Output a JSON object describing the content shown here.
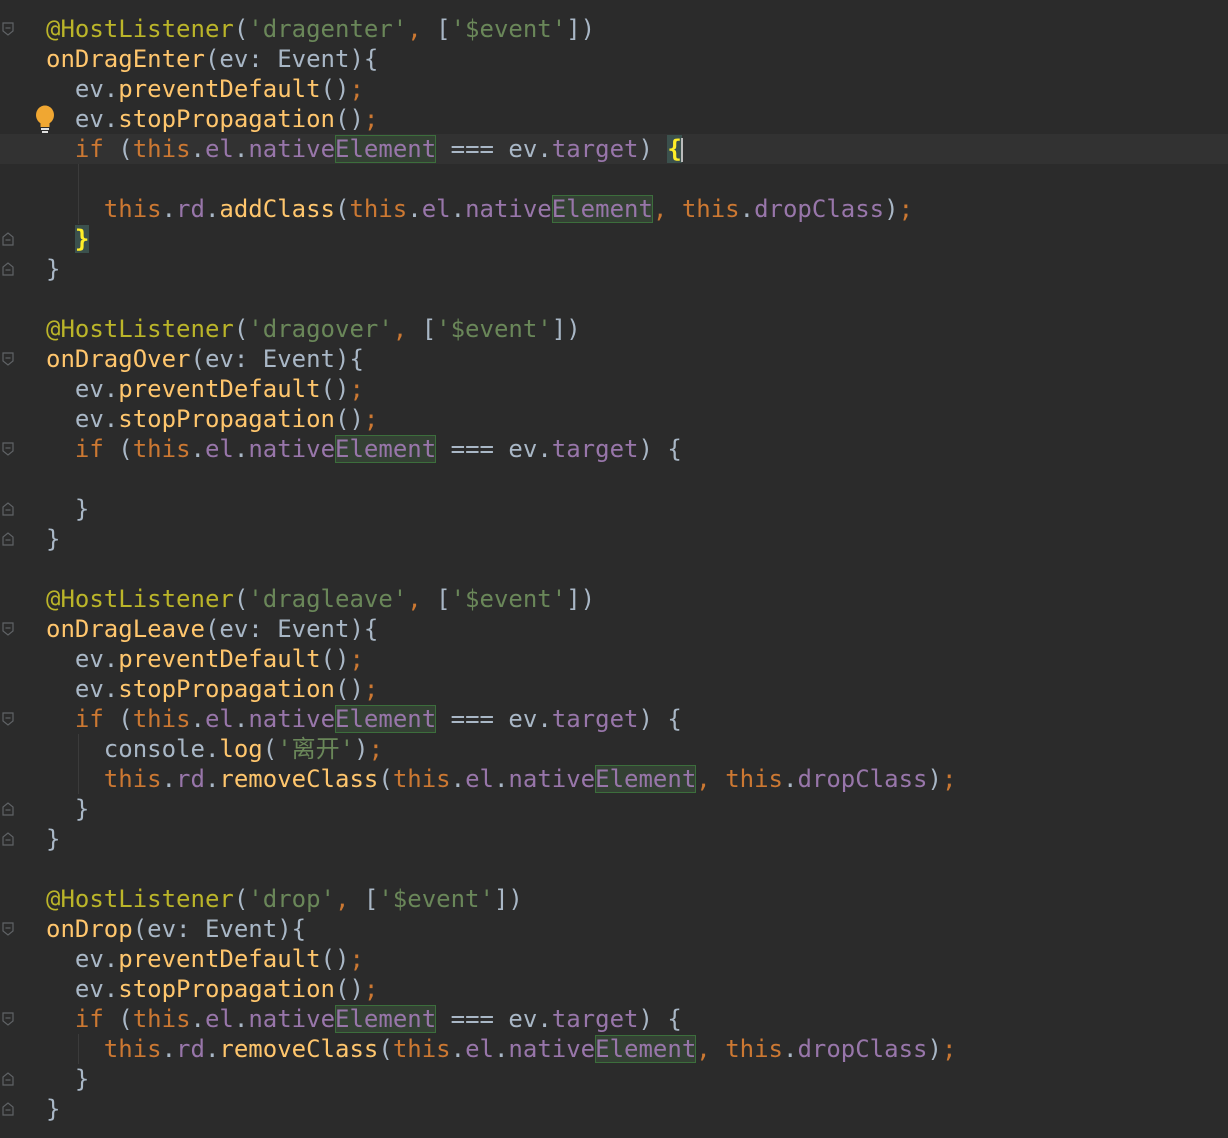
{
  "editor": {
    "colors": {
      "background": "#2b2b2b",
      "text": "#a9b7c6",
      "annotation": "#bbb529",
      "string": "#6a8759",
      "keyword": "#cc7832",
      "function": "#ffc66d",
      "property": "#9876aa",
      "highlight_bg": "#344134",
      "brace_match": "#ffef28"
    },
    "gutter": {
      "fold_markers": [
        "open",
        "",
        "",
        "",
        "open",
        "",
        "",
        "close",
        "close",
        "",
        "",
        "open",
        "",
        "",
        "open",
        "",
        "close",
        "close",
        "",
        "",
        "open",
        "",
        "",
        "open",
        "",
        "",
        "close",
        "close",
        "",
        "",
        "open",
        "",
        "",
        "open",
        "",
        "close",
        "close"
      ],
      "bulb_icon": "intention-bulb-icon"
    },
    "lines": [
      [
        {
          "t": "@HostListener",
          "c": "ann"
        },
        {
          "t": "(",
          "c": "txt"
        },
        {
          "t": "'dragenter'",
          "c": "str"
        },
        {
          "t": ", ",
          "c": "kw"
        },
        {
          "t": "[",
          "c": "txt"
        },
        {
          "t": "'$event'",
          "c": "str"
        },
        {
          "t": "])",
          "c": "txt"
        }
      ],
      [
        {
          "t": "onDragEnter",
          "c": "fn"
        },
        {
          "t": "(ev: Event){",
          "c": "txt"
        }
      ],
      [
        {
          "t": "  ev.",
          "c": "txt"
        },
        {
          "t": "preventDefault",
          "c": "fn"
        },
        {
          "t": "()",
          "c": "txt"
        },
        {
          "t": ";",
          "c": "kw"
        }
      ],
      [
        {
          "t": "  ev.",
          "c": "txt"
        },
        {
          "t": "stopPropagation",
          "c": "fn"
        },
        {
          "t": "()",
          "c": "txt"
        },
        {
          "t": ";",
          "c": "kw"
        }
      ],
      [
        {
          "t": "  ",
          "c": "txt"
        },
        {
          "t": "if",
          "c": "kw"
        },
        {
          "t": " (",
          "c": "txt"
        },
        {
          "t": "this",
          "c": "kw"
        },
        {
          "t": ".",
          "c": "txt"
        },
        {
          "t": "el",
          "c": "prop"
        },
        {
          "t": ".",
          "c": "txt"
        },
        {
          "t": "native",
          "c": "prop"
        },
        {
          "t": "Element",
          "c": "prop hl"
        },
        {
          "t": " === ev.",
          "c": "txt"
        },
        {
          "t": "target",
          "c": "prop"
        },
        {
          "t": ") ",
          "c": "txt"
        },
        {
          "t": "{",
          "c": "brace"
        }
      ],
      [],
      [
        {
          "t": "    ",
          "c": "txt"
        },
        {
          "t": "this",
          "c": "kw"
        },
        {
          "t": ".",
          "c": "txt"
        },
        {
          "t": "rd",
          "c": "prop"
        },
        {
          "t": ".",
          "c": "txt"
        },
        {
          "t": "addClass",
          "c": "fn"
        },
        {
          "t": "(",
          "c": "txt"
        },
        {
          "t": "this",
          "c": "kw"
        },
        {
          "t": ".",
          "c": "txt"
        },
        {
          "t": "el",
          "c": "prop"
        },
        {
          "t": ".",
          "c": "txt"
        },
        {
          "t": "native",
          "c": "prop"
        },
        {
          "t": "Element",
          "c": "prop hl"
        },
        {
          "t": ", ",
          "c": "kw"
        },
        {
          "t": "this",
          "c": "kw"
        },
        {
          "t": ".",
          "c": "txt"
        },
        {
          "t": "dropClass",
          "c": "prop"
        },
        {
          "t": ")",
          "c": "txt"
        },
        {
          "t": ";",
          "c": "kw"
        }
      ],
      [
        {
          "t": "  ",
          "c": "txt"
        },
        {
          "t": "}",
          "c": "brace"
        }
      ],
      [
        {
          "t": "}",
          "c": "txt"
        }
      ],
      [],
      [
        {
          "t": "@HostListener",
          "c": "ann"
        },
        {
          "t": "(",
          "c": "txt"
        },
        {
          "t": "'dragover'",
          "c": "str"
        },
        {
          "t": ", ",
          "c": "kw"
        },
        {
          "t": "[",
          "c": "txt"
        },
        {
          "t": "'$event'",
          "c": "str"
        },
        {
          "t": "])",
          "c": "txt"
        }
      ],
      [
        {
          "t": "onDragOver",
          "c": "fn"
        },
        {
          "t": "(ev: Event){",
          "c": "txt"
        }
      ],
      [
        {
          "t": "  ev.",
          "c": "txt"
        },
        {
          "t": "preventDefault",
          "c": "fn"
        },
        {
          "t": "()",
          "c": "txt"
        },
        {
          "t": ";",
          "c": "kw"
        }
      ],
      [
        {
          "t": "  ev.",
          "c": "txt"
        },
        {
          "t": "stopPropagation",
          "c": "fn"
        },
        {
          "t": "()",
          "c": "txt"
        },
        {
          "t": ";",
          "c": "kw"
        }
      ],
      [
        {
          "t": "  ",
          "c": "txt"
        },
        {
          "t": "if",
          "c": "kw"
        },
        {
          "t": " (",
          "c": "txt"
        },
        {
          "t": "this",
          "c": "kw"
        },
        {
          "t": ".",
          "c": "txt"
        },
        {
          "t": "el",
          "c": "prop"
        },
        {
          "t": ".",
          "c": "txt"
        },
        {
          "t": "native",
          "c": "prop"
        },
        {
          "t": "Element",
          "c": "prop hl"
        },
        {
          "t": " === ev.",
          "c": "txt"
        },
        {
          "t": "target",
          "c": "prop"
        },
        {
          "t": ") {",
          "c": "txt"
        }
      ],
      [],
      [
        {
          "t": "  }",
          "c": "txt"
        }
      ],
      [
        {
          "t": "}",
          "c": "txt"
        }
      ],
      [],
      [
        {
          "t": "@HostListener",
          "c": "ann"
        },
        {
          "t": "(",
          "c": "txt"
        },
        {
          "t": "'dragleave'",
          "c": "str"
        },
        {
          "t": ", ",
          "c": "kw"
        },
        {
          "t": "[",
          "c": "txt"
        },
        {
          "t": "'$event'",
          "c": "str"
        },
        {
          "t": "])",
          "c": "txt"
        }
      ],
      [
        {
          "t": "onDragLeave",
          "c": "fn"
        },
        {
          "t": "(ev: Event){",
          "c": "txt"
        }
      ],
      [
        {
          "t": "  ev.",
          "c": "txt"
        },
        {
          "t": "preventDefault",
          "c": "fn"
        },
        {
          "t": "()",
          "c": "txt"
        },
        {
          "t": ";",
          "c": "kw"
        }
      ],
      [
        {
          "t": "  ev.",
          "c": "txt"
        },
        {
          "t": "stopPropagation",
          "c": "fn"
        },
        {
          "t": "()",
          "c": "txt"
        },
        {
          "t": ";",
          "c": "kw"
        }
      ],
      [
        {
          "t": "  ",
          "c": "txt"
        },
        {
          "t": "if",
          "c": "kw"
        },
        {
          "t": " (",
          "c": "txt"
        },
        {
          "t": "this",
          "c": "kw"
        },
        {
          "t": ".",
          "c": "txt"
        },
        {
          "t": "el",
          "c": "prop"
        },
        {
          "t": ".",
          "c": "txt"
        },
        {
          "t": "native",
          "c": "prop"
        },
        {
          "t": "Element",
          "c": "prop hl"
        },
        {
          "t": " === ev.",
          "c": "txt"
        },
        {
          "t": "target",
          "c": "prop"
        },
        {
          "t": ") {",
          "c": "txt"
        }
      ],
      [
        {
          "t": "    console.",
          "c": "txt"
        },
        {
          "t": "log",
          "c": "fn"
        },
        {
          "t": "(",
          "c": "txt"
        },
        {
          "t": "'离开'",
          "c": "str"
        },
        {
          "t": ")",
          "c": "txt"
        },
        {
          "t": ";",
          "c": "kw"
        }
      ],
      [
        {
          "t": "    ",
          "c": "txt"
        },
        {
          "t": "this",
          "c": "kw"
        },
        {
          "t": ".",
          "c": "txt"
        },
        {
          "t": "rd",
          "c": "prop"
        },
        {
          "t": ".",
          "c": "txt"
        },
        {
          "t": "removeClass",
          "c": "fn"
        },
        {
          "t": "(",
          "c": "txt"
        },
        {
          "t": "this",
          "c": "kw"
        },
        {
          "t": ".",
          "c": "txt"
        },
        {
          "t": "el",
          "c": "prop"
        },
        {
          "t": ".",
          "c": "txt"
        },
        {
          "t": "native",
          "c": "prop"
        },
        {
          "t": "Element",
          "c": "prop hl"
        },
        {
          "t": ", ",
          "c": "kw"
        },
        {
          "t": "this",
          "c": "kw"
        },
        {
          "t": ".",
          "c": "txt"
        },
        {
          "t": "dropClass",
          "c": "prop"
        },
        {
          "t": ")",
          "c": "txt"
        },
        {
          "t": ";",
          "c": "kw"
        }
      ],
      [
        {
          "t": "  }",
          "c": "txt"
        }
      ],
      [
        {
          "t": "}",
          "c": "txt"
        }
      ],
      [],
      [
        {
          "t": "@HostListener",
          "c": "ann"
        },
        {
          "t": "(",
          "c": "txt"
        },
        {
          "t": "'drop'",
          "c": "str"
        },
        {
          "t": ", ",
          "c": "kw"
        },
        {
          "t": "[",
          "c": "txt"
        },
        {
          "t": "'$event'",
          "c": "str"
        },
        {
          "t": "])",
          "c": "txt"
        }
      ],
      [
        {
          "t": "onDrop",
          "c": "fn"
        },
        {
          "t": "(ev: Event){",
          "c": "txt"
        }
      ],
      [
        {
          "t": "  ev.",
          "c": "txt"
        },
        {
          "t": "preventDefault",
          "c": "fn"
        },
        {
          "t": "()",
          "c": "txt"
        },
        {
          "t": ";",
          "c": "kw"
        }
      ],
      [
        {
          "t": "  ev.",
          "c": "txt"
        },
        {
          "t": "stopPropagation",
          "c": "fn"
        },
        {
          "t": "()",
          "c": "txt"
        },
        {
          "t": ";",
          "c": "kw"
        }
      ],
      [
        {
          "t": "  ",
          "c": "txt"
        },
        {
          "t": "if",
          "c": "kw"
        },
        {
          "t": " (",
          "c": "txt"
        },
        {
          "t": "this",
          "c": "kw"
        },
        {
          "t": ".",
          "c": "txt"
        },
        {
          "t": "el",
          "c": "prop"
        },
        {
          "t": ".",
          "c": "txt"
        },
        {
          "t": "native",
          "c": "prop"
        },
        {
          "t": "Element",
          "c": "prop hl"
        },
        {
          "t": " === ev.",
          "c": "txt"
        },
        {
          "t": "target",
          "c": "prop"
        },
        {
          "t": ") {",
          "c": "txt"
        }
      ],
      [
        {
          "t": "    ",
          "c": "txt"
        },
        {
          "t": "this",
          "c": "kw"
        },
        {
          "t": ".",
          "c": "txt"
        },
        {
          "t": "rd",
          "c": "prop"
        },
        {
          "t": ".",
          "c": "txt"
        },
        {
          "t": "removeClass",
          "c": "fn"
        },
        {
          "t": "(",
          "c": "txt"
        },
        {
          "t": "this",
          "c": "kw"
        },
        {
          "t": ".",
          "c": "txt"
        },
        {
          "t": "el",
          "c": "prop"
        },
        {
          "t": ".",
          "c": "txt"
        },
        {
          "t": "native",
          "c": "prop"
        },
        {
          "t": "Element",
          "c": "prop hl"
        },
        {
          "t": ", ",
          "c": "kw"
        },
        {
          "t": "this",
          "c": "kw"
        },
        {
          "t": ".",
          "c": "txt"
        },
        {
          "t": "dropClass",
          "c": "prop"
        },
        {
          "t": ")",
          "c": "txt"
        },
        {
          "t": ";",
          "c": "kw"
        }
      ],
      [
        {
          "t": "  }",
          "c": "txt"
        }
      ],
      [
        {
          "t": "}",
          "c": "txt"
        }
      ]
    ],
    "caret_line": 4
  }
}
